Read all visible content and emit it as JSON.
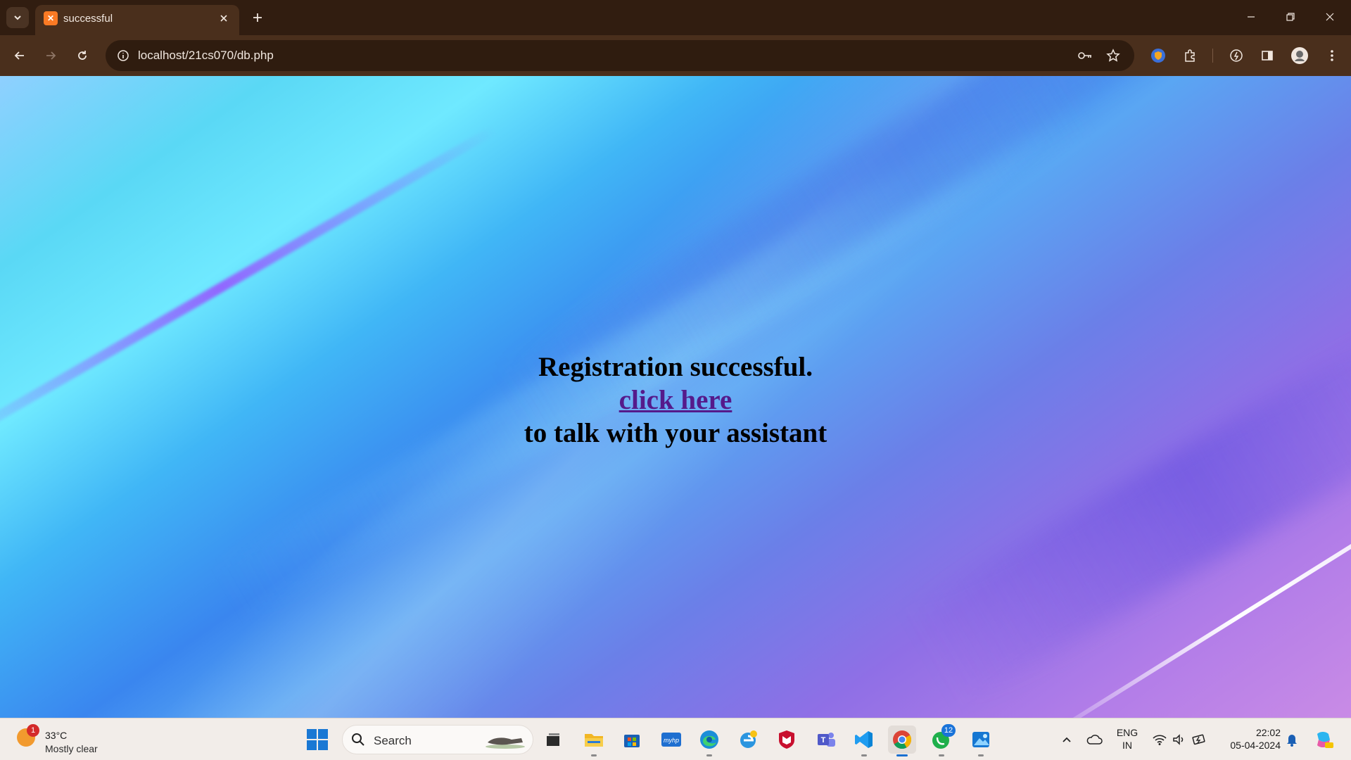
{
  "browser": {
    "tab": {
      "title": "successful"
    },
    "address": {
      "url": "localhost/21cs070/db.php"
    }
  },
  "page": {
    "heading": "Registration successful.",
    "link_text": "click here",
    "subtext": "to talk with your assistant"
  },
  "taskbar": {
    "weather": {
      "temp": "33°C",
      "condition": "Mostly clear",
      "badge": "1"
    },
    "search": {
      "placeholder": "Search"
    },
    "whatsapp_badge": "12",
    "language": {
      "line1": "ENG",
      "line2": "IN"
    },
    "clock": {
      "time": "22:02",
      "date": "05-04-2024"
    }
  },
  "colors": {
    "browser_frame": "#311d10",
    "toolbar": "#4a2f1c",
    "link": "#551a8b",
    "taskbar": "#f2ede9"
  }
}
